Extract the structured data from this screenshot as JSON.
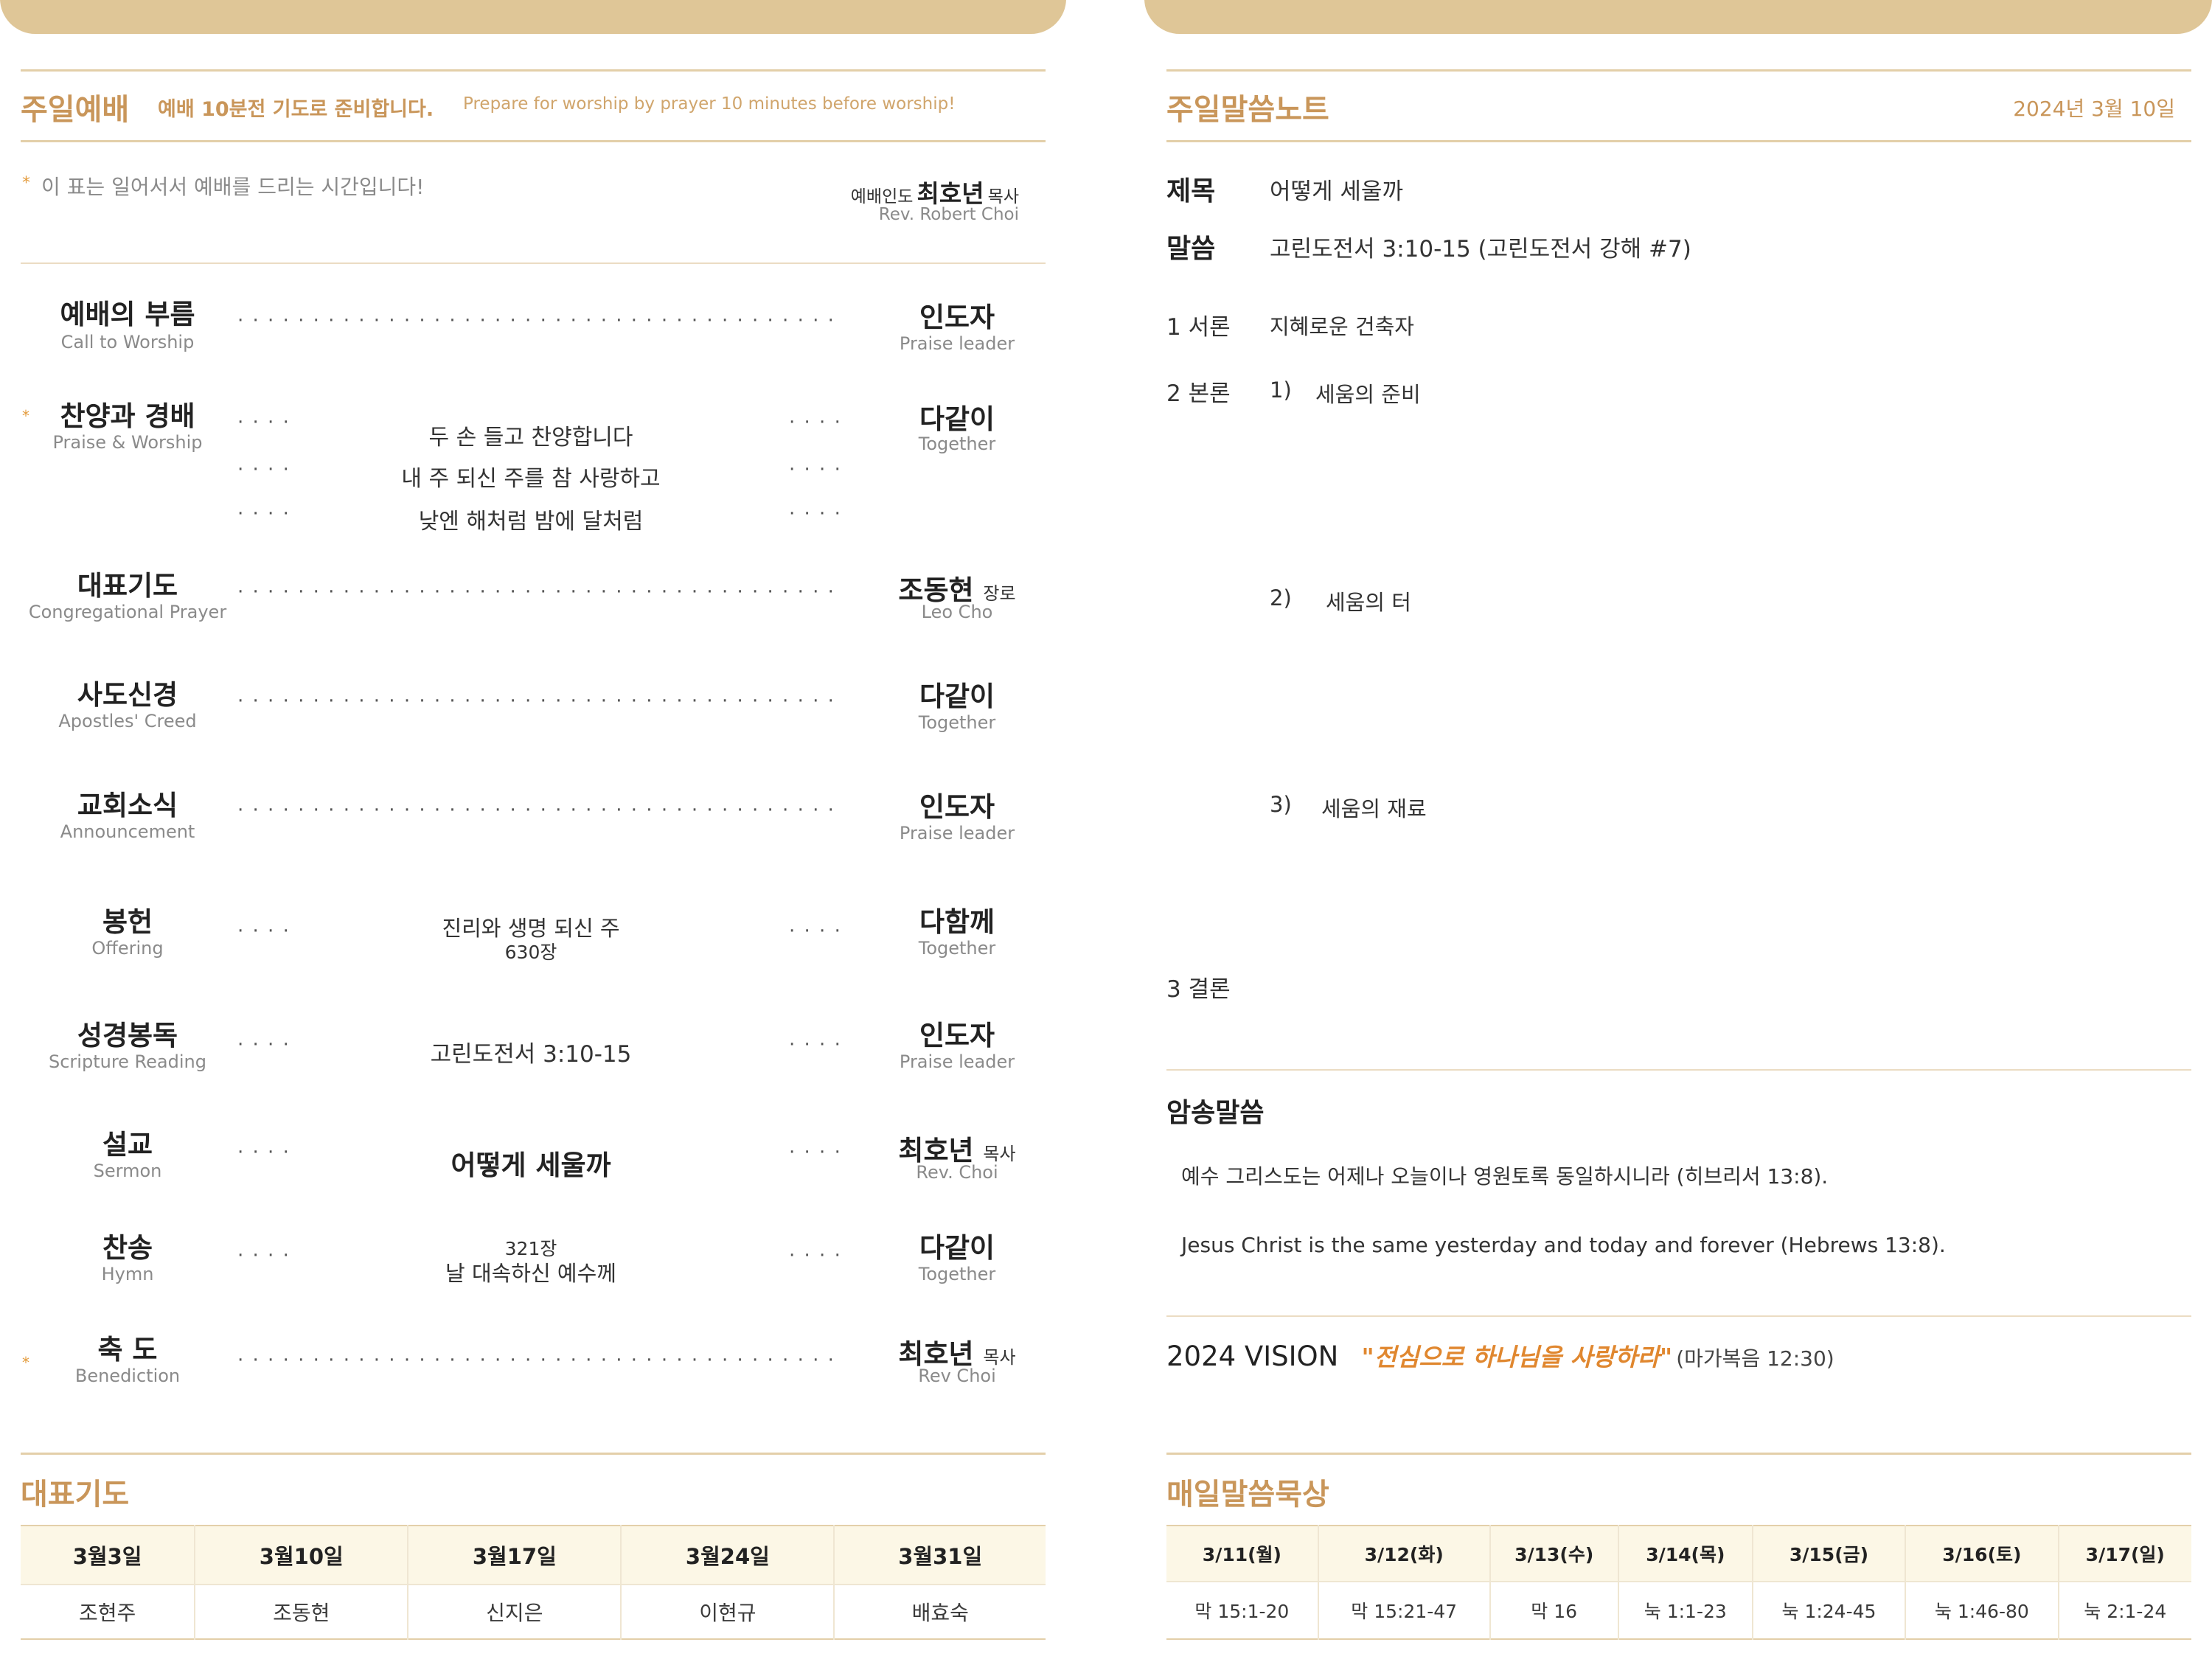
{
  "worship": {
    "title": "주일예배",
    "sub_kor": "예배 10분전 기도로 준비합니다.",
    "sub_eng": "Prepare for worship by prayer 10 minutes before worship!",
    "stand_note": "이 표는 일어서서 예배를 드리는 시간입니다!",
    "star_glyph": "*",
    "leader_role": "예배인도",
    "leader_name": "최호년",
    "leader_title": "목사",
    "leader_eng": "Rev. Robert Choi",
    "dots_short": "· · · ·",
    "dots_long": "· · · · · · · · · · · · · · · · · · · · · · · · · · · · · · · · · · · · · · · · · · · · · · · · · · ·",
    "items": [
      {
        "kor": "예배의 부름",
        "eng": "Call to Worship",
        "lead": "인도자",
        "lead_title": "",
        "lead_eng": "Praise leader"
      },
      {
        "kor": "찬양과 경배",
        "eng": "Praise & Worship",
        "lines": [
          "두 손 들고 찬양합니다",
          "내 주 되신 주를 참 사랑하고",
          "낮엔 해처럼 밤에 달처럼"
        ],
        "lead": "다같이",
        "lead_title": "",
        "lead_eng": "Together"
      },
      {
        "kor": "대표기도",
        "eng": "Congregational Prayer",
        "lead": "조동현",
        "lead_title": "장로",
        "lead_eng": "Leo Cho"
      },
      {
        "kor": "사도신경",
        "eng": "Apostles' Creed",
        "lead": "다같이",
        "lead_title": "",
        "lead_eng": "Together"
      },
      {
        "kor": "교회소식",
        "eng": "Announcement",
        "lead": "인도자",
        "lead_title": "",
        "lead_eng": "Praise leader"
      },
      {
        "kor": "봉헌",
        "eng": "Offering",
        "mid": "진리와 생명 되신 주",
        "mid2": "630장",
        "lead": "다함께",
        "lead_title": "",
        "lead_eng": "Together"
      },
      {
        "kor": "성경봉독",
        "eng": "Scripture Reading",
        "mid": "고린도전서 3:10-15",
        "lead": "인도자",
        "lead_title": "",
        "lead_eng": "Praise leader"
      },
      {
        "kor": "설교",
        "eng": "Sermon",
        "mid": "어떻게 세울까",
        "lead": "최호년",
        "lead_title": "목사",
        "lead_eng": "Rev. Choi"
      },
      {
        "kor": "찬송",
        "eng": "Hymn",
        "mid": "321장",
        "mid2": "날 대속하신 예수께",
        "lead": "다같이",
        "lead_title": "",
        "lead_eng": "Together"
      },
      {
        "kor": "축 도",
        "eng": "Benediction",
        "lead": "최호년",
        "lead_title": "목사",
        "lead_eng": "Rev Choi"
      }
    ]
  },
  "prayer": {
    "title": "대표기도",
    "dates": [
      "3월3일",
      "3월10일",
      "3월17일",
      "3월24일",
      "3월31일"
    ],
    "names": [
      "조현주",
      "조동현",
      "신지은",
      "이현규",
      "배효숙"
    ]
  },
  "notes": {
    "title": "주일말씀노트",
    "date": "2024년 3월 10일",
    "topic_label": "제목",
    "topic": "어떻게 세울까",
    "scripture_label": "말씀",
    "scripture": "고린도전서 3:10-15 (고린도전서 강해 #7)",
    "intro_label": "1 서론",
    "intro": "지혜로운 건축자",
    "body_label": "2 본론",
    "points": [
      {
        "num": "1)",
        "text": "세움의 준비"
      },
      {
        "num": "2)",
        "text": "세움의 터"
      },
      {
        "num": "3)",
        "text": "세움의 재료"
      }
    ],
    "conclusion_label": "3 결론"
  },
  "memory": {
    "title": "암송말씀",
    "kor": "예수 그리스도는 어제나 오늘이나 영원토록 동일하시니라 (히브리서 13:8).",
    "eng": "Jesus Christ is the same yesterday and today and forever (Hebrews 13:8)."
  },
  "vision": {
    "label": "2024 VISION",
    "quote": "\"전심으로 하나님을 사랑하라\"",
    "ref": "(마가복음 12:30)"
  },
  "daily": {
    "title": "매일말씀묵상",
    "days": [
      "3/11(월)",
      "3/12(화)",
      "3/13(수)",
      "3/14(목)",
      "3/15(금)",
      "3/16(토)",
      "3/17(일)"
    ],
    "readings": [
      "막 15:1-20",
      "막 15:21-47",
      "막 16",
      "눅 1:1-23",
      "눅 1:24-45",
      "눅 1:46-80",
      "눅 2:1-24"
    ]
  },
  "colors": {
    "accent": "#c9965a",
    "tab": "#dfc697",
    "vision_quote": "#e0872f",
    "rule": "#e3cfa9",
    "table_head": "#fcf7e6"
  }
}
